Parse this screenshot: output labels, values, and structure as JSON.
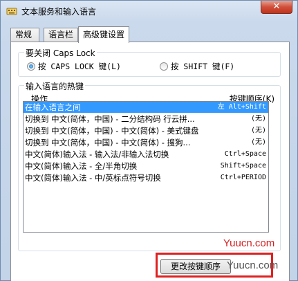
{
  "window": {
    "title": "文本服务和输入语言",
    "close_label": "✕"
  },
  "tabs": [
    {
      "label": "常规"
    },
    {
      "label": "语言栏"
    },
    {
      "label": "高级键设置"
    }
  ],
  "caps_lock": {
    "legend": "要关闭 Caps Lock",
    "option1": "按 CAPS LOCK 键(L)",
    "option2": "按 SHIFT 键(F)"
  },
  "hotkeys": {
    "legend": "输入语言的热键",
    "col_action": "操作",
    "col_keys": "按键顺序(K)",
    "rows": [
      {
        "action": "在输入语言之间",
        "keys": "左 Alt+Shift"
      },
      {
        "action": "切换到 中文(简体，中国) - 二分结构码 行云拼...",
        "keys": "(无)"
      },
      {
        "action": "切换到 中文(简体，中国) - 中文(简体) - 美式键盘",
        "keys": "(无)"
      },
      {
        "action": "切换到 中文(简体，中国) - 中文(简体) - 搜狗...",
        "keys": "(无)"
      },
      {
        "action": "中文(简体)输入法 - 输入法/非输入法切换",
        "keys": "Ctrl+Space"
      },
      {
        "action": "中文(简体)输入法 - 全/半角切换",
        "keys": "Shift+Space"
      },
      {
        "action": "中文(简体)输入法 - 中/英标点符号切换",
        "keys": "Ctrl+PERIOD"
      }
    ],
    "change_button": "更改按键顺序"
  },
  "watermark": {
    "line1": "Yuucn.com",
    "line2": "Yuucn.com"
  }
}
